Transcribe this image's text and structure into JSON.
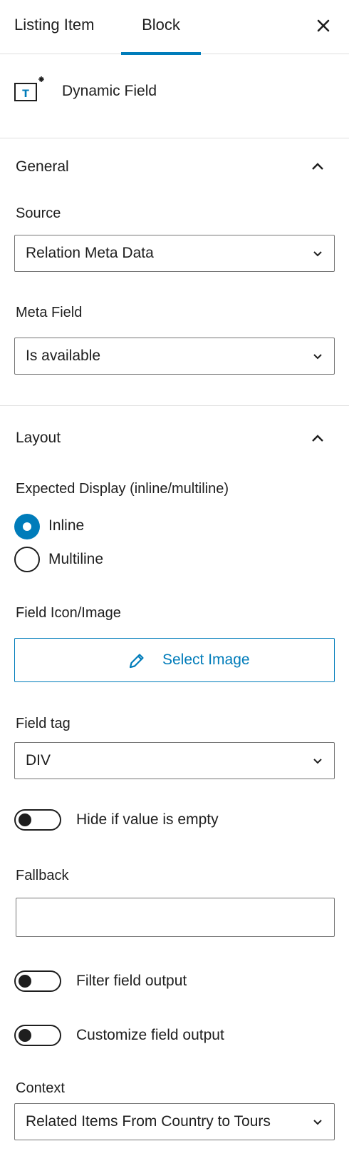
{
  "tabs": [
    {
      "label": "Listing Item",
      "active": false
    },
    {
      "label": "Block",
      "active": true
    }
  ],
  "close_icon": "close-icon",
  "accent_color": "#007cba",
  "block": {
    "title": "Dynamic Field",
    "icon": "dynamic-field-icon"
  },
  "general": {
    "title": "General",
    "source": {
      "label": "Source",
      "value": "Relation Meta Data"
    },
    "meta_field": {
      "label": "Meta Field",
      "value": "Is available"
    }
  },
  "layout": {
    "title": "Layout",
    "expected_display": {
      "label": "Expected Display (inline/multiline)",
      "options": [
        {
          "label": "Inline",
          "selected": true
        },
        {
          "label": "Multiline",
          "selected": false
        }
      ]
    },
    "field_icon": {
      "label": "Field Icon/Image",
      "button": "Select Image"
    },
    "field_tag": {
      "label": "Field tag",
      "value": "DIV"
    },
    "hide_if_empty": {
      "label": "Hide if value is empty",
      "checked": false
    },
    "fallback": {
      "label": "Fallback",
      "value": ""
    },
    "filter_output": {
      "label": "Filter field output",
      "checked": false
    },
    "customize_output": {
      "label": "Customize field output",
      "checked": false
    },
    "context": {
      "label": "Context",
      "value": "Related Items From Country to Tours"
    }
  }
}
